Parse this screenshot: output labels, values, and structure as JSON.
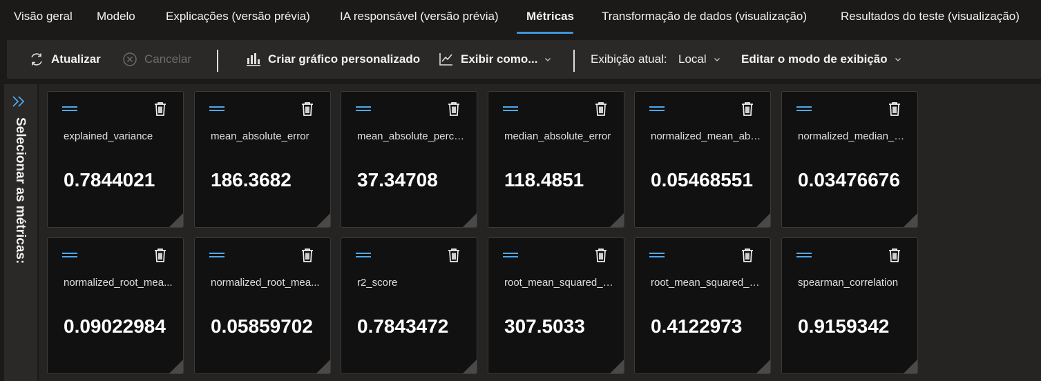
{
  "tabs": [
    {
      "label": "Visão geral"
    },
    {
      "label": "Modelo"
    },
    {
      "label": "Explicações (versão prévia)"
    },
    {
      "label": "IA responsável (versão prévia)"
    },
    {
      "label": "Métricas",
      "active": true
    },
    {
      "label": "Transformação de dados (visualização)"
    },
    {
      "label": "Resultados do teste (visualização)"
    }
  ],
  "toolbar": {
    "refresh_label": "Atualizar",
    "cancel_label": "Cancelar",
    "custom_chart_label": "Criar gráfico personalizado",
    "view_as_label": "Exibir como...",
    "current_view_label": "Exibição atual:",
    "current_view_value": "Local",
    "edit_view_label": "Editar o modo de exibição"
  },
  "side_panel": {
    "label": "Selecionar as métricas:"
  },
  "metrics": [
    {
      "name": "explained_variance",
      "value": "0.7844021"
    },
    {
      "name": "mean_absolute_error",
      "value": "186.3682"
    },
    {
      "name": "mean_absolute_perce...",
      "value": "37.34708"
    },
    {
      "name": "median_absolute_error",
      "value": "118.4851"
    },
    {
      "name": "normalized_mean_abs...",
      "value": "0.05468551"
    },
    {
      "name": "normalized_median_a...",
      "value": "0.03476676"
    },
    {
      "name": "normalized_root_mea...",
      "value": "0.09022984"
    },
    {
      "name": "normalized_root_mea...",
      "value": "0.05859702"
    },
    {
      "name": "r2_score",
      "value": "0.7843472"
    },
    {
      "name": "root_mean_squared_er...",
      "value": "307.5033"
    },
    {
      "name": "root_mean_squared_lo...",
      "value": "0.4122973"
    },
    {
      "name": "spearman_correlation",
      "value": "0.9159342"
    }
  ],
  "colors": {
    "accent": "#3a96dd",
    "card_background": "#111111",
    "page_background": "#1b1a19"
  }
}
